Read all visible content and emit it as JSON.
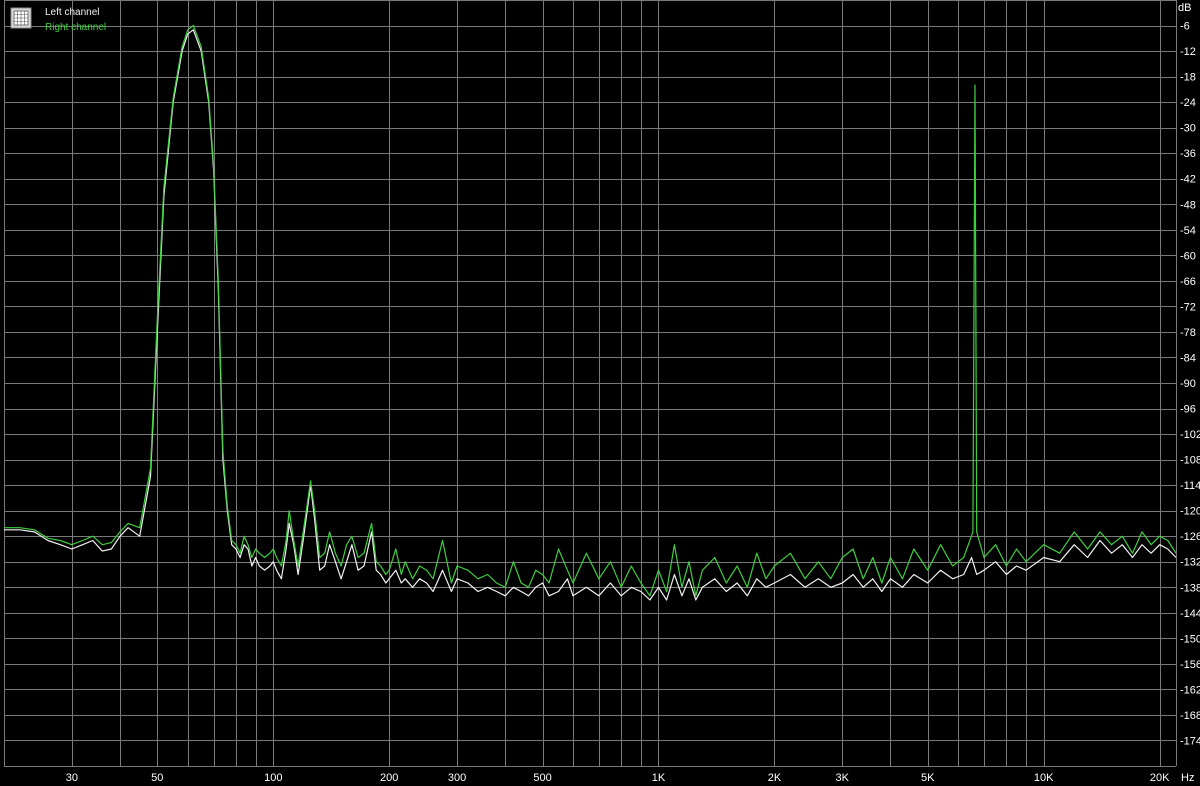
{
  "colors": {
    "background": "#000000",
    "grid": "#7a7a7a",
    "left_channel": "#f2f2f2",
    "right_channel": "#3ecf3e"
  },
  "legend": {
    "icon": "grid-icon",
    "items": [
      "Left channel",
      "Right channel"
    ]
  },
  "chart_data": {
    "type": "line",
    "title": "",
    "xlabel": "Hz",
    "ylabel": "dB",
    "x_scale": "log",
    "xlim": [
      20,
      22050
    ],
    "ylim": [
      -180,
      0
    ],
    "grid": true,
    "legend_position": "top-left",
    "x_ticks": [
      {
        "value": 30,
        "label": "30"
      },
      {
        "value": 50,
        "label": "50"
      },
      {
        "value": 100,
        "label": "100"
      },
      {
        "value": 200,
        "label": "200"
      },
      {
        "value": 300,
        "label": "300"
      },
      {
        "value": 500,
        "label": "500"
      },
      {
        "value": 1000,
        "label": "1K"
      },
      {
        "value": 2000,
        "label": "2K"
      },
      {
        "value": 3000,
        "label": "3K"
      },
      {
        "value": 5000,
        "label": "5K"
      },
      {
        "value": 10000,
        "label": "10K"
      },
      {
        "value": 20000,
        "label": "20K"
      }
    ],
    "x_grid_values": [
      20,
      30,
      40,
      50,
      60,
      70,
      80,
      90,
      100,
      200,
      300,
      400,
      500,
      600,
      700,
      800,
      900,
      1000,
      2000,
      3000,
      4000,
      5000,
      6000,
      7000,
      8000,
      9000,
      10000,
      20000
    ],
    "y_ticks": [
      -6,
      -12,
      -18,
      -24,
      -30,
      -36,
      -42,
      -48,
      -54,
      -60,
      -66,
      -72,
      -78,
      -84,
      -90,
      -96,
      -102,
      -108,
      -114,
      -120,
      -126,
      -132,
      -138,
      -144,
      -150,
      -156,
      -162,
      -168,
      -174
    ],
    "series": [
      {
        "name": "Left channel",
        "color": "#f2f2f2",
        "points": [
          [
            20,
            -124.5
          ],
          [
            22,
            -124.5
          ],
          [
            24,
            -125
          ],
          [
            26,
            -127
          ],
          [
            28,
            -128
          ],
          [
            30,
            -129
          ],
          [
            32,
            -128
          ],
          [
            34,
            -127
          ],
          [
            36,
            -129.5
          ],
          [
            38,
            -129
          ],
          [
            40,
            -126
          ],
          [
            42,
            -124
          ],
          [
            45,
            -126
          ],
          [
            48,
            -112
          ],
          [
            50,
            -78
          ],
          [
            52,
            -46
          ],
          [
            55,
            -24
          ],
          [
            58,
            -12
          ],
          [
            60,
            -8
          ],
          [
            62,
            -7
          ],
          [
            65,
            -12
          ],
          [
            68,
            -24
          ],
          [
            70,
            -40
          ],
          [
            72,
            -68
          ],
          [
            74,
            -108
          ],
          [
            76,
            -120
          ],
          [
            78,
            -128
          ],
          [
            80,
            -129
          ],
          [
            82,
            -131
          ],
          [
            84,
            -128
          ],
          [
            86,
            -129
          ],
          [
            88,
            -133
          ],
          [
            90,
            -131
          ],
          [
            92,
            -133
          ],
          [
            95,
            -134
          ],
          [
            98,
            -133
          ],
          [
            100,
            -132
          ],
          [
            102,
            -134
          ],
          [
            105,
            -136
          ],
          [
            108,
            -129
          ],
          [
            110,
            -123
          ],
          [
            113,
            -128
          ],
          [
            116,
            -135
          ],
          [
            120,
            -126
          ],
          [
            125,
            -114
          ],
          [
            128,
            -122
          ],
          [
            132,
            -134
          ],
          [
            136,
            -133
          ],
          [
            140,
            -128
          ],
          [
            145,
            -132
          ],
          [
            150,
            -136
          ],
          [
            155,
            -132
          ],
          [
            160,
            -128
          ],
          [
            166,
            -134
          ],
          [
            172,
            -133
          ],
          [
            180,
            -125
          ],
          [
            185,
            -134
          ],
          [
            190,
            -135
          ],
          [
            196,
            -137
          ],
          [
            200,
            -136
          ],
          [
            208,
            -134
          ],
          [
            215,
            -137
          ],
          [
            220,
            -136
          ],
          [
            230,
            -138
          ],
          [
            240,
            -136
          ],
          [
            250,
            -137
          ],
          [
            260,
            -139
          ],
          [
            275,
            -134
          ],
          [
            290,
            -139
          ],
          [
            300,
            -136
          ],
          [
            320,
            -137
          ],
          [
            340,
            -139
          ],
          [
            360,
            -138
          ],
          [
            380,
            -139
          ],
          [
            400,
            -140
          ],
          [
            420,
            -138
          ],
          [
            440,
            -139
          ],
          [
            460,
            -140
          ],
          [
            480,
            -138
          ],
          [
            500,
            -137
          ],
          [
            520,
            -140
          ],
          [
            550,
            -139
          ],
          [
            580,
            -136
          ],
          [
            600,
            -140
          ],
          [
            650,
            -138
          ],
          [
            700,
            -140
          ],
          [
            750,
            -137
          ],
          [
            800,
            -140
          ],
          [
            850,
            -138
          ],
          [
            900,
            -139
          ],
          [
            950,
            -141
          ],
          [
            1000,
            -138
          ],
          [
            1050,
            -141
          ],
          [
            1100,
            -135
          ],
          [
            1150,
            -140
          ],
          [
            1200,
            -136
          ],
          [
            1250,
            -141
          ],
          [
            1300,
            -138
          ],
          [
            1400,
            -136
          ],
          [
            1500,
            -139
          ],
          [
            1600,
            -137
          ],
          [
            1700,
            -140
          ],
          [
            1800,
            -136
          ],
          [
            1900,
            -138
          ],
          [
            2000,
            -137
          ],
          [
            2200,
            -135
          ],
          [
            2400,
            -138
          ],
          [
            2600,
            -136
          ],
          [
            2800,
            -138
          ],
          [
            3000,
            -137
          ],
          [
            3200,
            -135
          ],
          [
            3400,
            -138
          ],
          [
            3600,
            -136
          ],
          [
            3800,
            -139
          ],
          [
            4000,
            -136
          ],
          [
            4300,
            -138
          ],
          [
            4600,
            -135
          ],
          [
            5000,
            -137
          ],
          [
            5400,
            -134
          ],
          [
            5800,
            -136
          ],
          [
            6200,
            -135
          ],
          [
            6500,
            -131
          ],
          [
            6700,
            -135
          ],
          [
            7000,
            -134
          ],
          [
            7500,
            -132
          ],
          [
            8000,
            -135
          ],
          [
            8500,
            -133
          ],
          [
            9000,
            -134
          ],
          [
            10000,
            -131
          ],
          [
            11000,
            -132
          ],
          [
            12000,
            -128
          ],
          [
            13000,
            -131
          ],
          [
            14000,
            -127
          ],
          [
            15000,
            -130
          ],
          [
            16000,
            -128
          ],
          [
            17000,
            -131
          ],
          [
            18000,
            -128
          ],
          [
            19000,
            -130
          ],
          [
            20000,
            -128
          ],
          [
            21000,
            -129
          ],
          [
            22050,
            -131
          ]
        ]
      },
      {
        "name": "Right channel",
        "color": "#3ecf3e",
        "points": [
          [
            20,
            -124
          ],
          [
            22,
            -124
          ],
          [
            24,
            -124.5
          ],
          [
            26,
            -126.5
          ],
          [
            28,
            -127
          ],
          [
            30,
            -128
          ],
          [
            32,
            -127
          ],
          [
            34,
            -126
          ],
          [
            36,
            -128
          ],
          [
            38,
            -127.5
          ],
          [
            40,
            -125
          ],
          [
            42,
            -123
          ],
          [
            45,
            -124
          ],
          [
            48,
            -110
          ],
          [
            50,
            -75
          ],
          [
            52,
            -44
          ],
          [
            55,
            -23
          ],
          [
            58,
            -11
          ],
          [
            60,
            -7
          ],
          [
            62,
            -6
          ],
          [
            65,
            -11
          ],
          [
            68,
            -23
          ],
          [
            70,
            -39
          ],
          [
            72,
            -66
          ],
          [
            74,
            -106
          ],
          [
            76,
            -119
          ],
          [
            78,
            -127
          ],
          [
            80,
            -128
          ],
          [
            82,
            -130
          ],
          [
            84,
            -126
          ],
          [
            86,
            -128
          ],
          [
            88,
            -131
          ],
          [
            90,
            -129
          ],
          [
            92,
            -130
          ],
          [
            95,
            -131
          ],
          [
            98,
            -130
          ],
          [
            100,
            -129
          ],
          [
            102,
            -131
          ],
          [
            105,
            -133
          ],
          [
            108,
            -127
          ],
          [
            110,
            -120
          ],
          [
            113,
            -127
          ],
          [
            116,
            -133
          ],
          [
            120,
            -124
          ],
          [
            125,
            -113
          ],
          [
            128,
            -120
          ],
          [
            132,
            -131
          ],
          [
            136,
            -130
          ],
          [
            140,
            -125
          ],
          [
            145,
            -130
          ],
          [
            150,
            -133
          ],
          [
            155,
            -128
          ],
          [
            160,
            -126
          ],
          [
            166,
            -131
          ],
          [
            172,
            -130
          ],
          [
            180,
            -123
          ],
          [
            185,
            -132
          ],
          [
            190,
            -133
          ],
          [
            196,
            -135
          ],
          [
            200,
            -134
          ],
          [
            208,
            -129
          ],
          [
            215,
            -135
          ],
          [
            220,
            -132
          ],
          [
            230,
            -136
          ],
          [
            240,
            -133
          ],
          [
            250,
            -134
          ],
          [
            260,
            -136
          ],
          [
            275,
            -127
          ],
          [
            290,
            -137
          ],
          [
            300,
            -133
          ],
          [
            320,
            -134
          ],
          [
            340,
            -136
          ],
          [
            360,
            -135
          ],
          [
            380,
            -137
          ],
          [
            400,
            -138
          ],
          [
            420,
            -132
          ],
          [
            440,
            -137
          ],
          [
            460,
            -138
          ],
          [
            480,
            -134
          ],
          [
            500,
            -135
          ],
          [
            520,
            -137
          ],
          [
            550,
            -129
          ],
          [
            580,
            -134
          ],
          [
            600,
            -137
          ],
          [
            650,
            -130
          ],
          [
            700,
            -136
          ],
          [
            750,
            -132
          ],
          [
            800,
            -138
          ],
          [
            850,
            -133
          ],
          [
            900,
            -137
          ],
          [
            950,
            -140
          ],
          [
            1000,
            -134
          ],
          [
            1050,
            -139
          ],
          [
            1100,
            -128
          ],
          [
            1150,
            -138
          ],
          [
            1200,
            -132
          ],
          [
            1250,
            -140
          ],
          [
            1300,
            -134
          ],
          [
            1400,
            -131
          ],
          [
            1500,
            -137
          ],
          [
            1600,
            -133
          ],
          [
            1700,
            -138
          ],
          [
            1800,
            -130
          ],
          [
            1900,
            -136
          ],
          [
            2000,
            -133
          ],
          [
            2200,
            -130
          ],
          [
            2400,
            -136
          ],
          [
            2600,
            -132
          ],
          [
            2800,
            -136
          ],
          [
            3000,
            -131
          ],
          [
            3200,
            -129
          ],
          [
            3400,
            -136
          ],
          [
            3600,
            -131
          ],
          [
            3800,
            -137
          ],
          [
            4000,
            -131
          ],
          [
            4300,
            -136
          ],
          [
            4600,
            -129
          ],
          [
            5000,
            -134
          ],
          [
            5400,
            -128
          ],
          [
            5800,
            -133
          ],
          [
            6200,
            -131
          ],
          [
            6550,
            -125
          ],
          [
            6630,
            -20
          ],
          [
            6700,
            -125
          ],
          [
            7000,
            -131
          ],
          [
            7500,
            -128
          ],
          [
            8000,
            -133
          ],
          [
            8500,
            -129
          ],
          [
            9000,
            -132
          ],
          [
            10000,
            -128
          ],
          [
            11000,
            -130
          ],
          [
            12000,
            -125
          ],
          [
            13000,
            -129
          ],
          [
            14000,
            -125
          ],
          [
            15000,
            -128
          ],
          [
            16000,
            -126
          ],
          [
            17000,
            -130
          ],
          [
            18000,
            -125
          ],
          [
            19000,
            -128
          ],
          [
            20000,
            -126
          ],
          [
            21000,
            -127
          ],
          [
            22050,
            -130
          ]
        ]
      }
    ]
  }
}
